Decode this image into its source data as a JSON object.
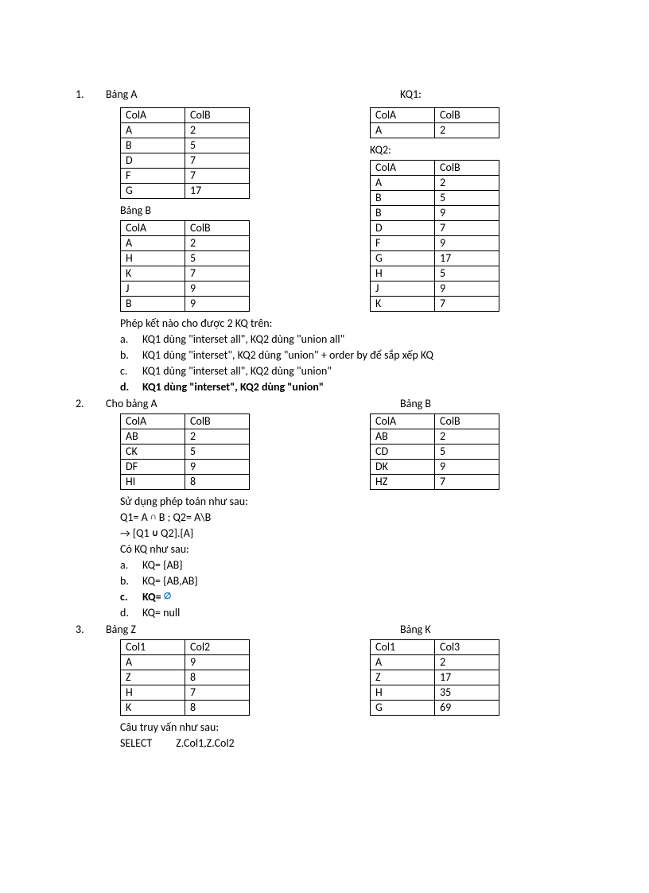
{
  "q1": {
    "num": "1.",
    "titleA": "Bảng A",
    "titleKQ1": "KQ1:",
    "titleB": "Bảng B",
    "titleKQ2": "KQ2:",
    "tableA": {
      "headers": [
        "ColA",
        "ColB"
      ],
      "rows": [
        [
          "A",
          "2"
        ],
        [
          "B",
          "5"
        ],
        [
          "D",
          "7"
        ],
        [
          "F",
          "7"
        ],
        [
          "G",
          "17"
        ]
      ]
    },
    "tableKQ1": {
      "headers": [
        "ColA",
        "ColB"
      ],
      "rows": [
        [
          "A",
          "2"
        ]
      ]
    },
    "tableB": {
      "headers": [
        "ColA",
        "ColB"
      ],
      "rows": [
        [
          "A",
          "2"
        ],
        [
          "H",
          "5"
        ],
        [
          "K",
          "7"
        ],
        [
          "J",
          "9"
        ],
        [
          "B",
          "9"
        ]
      ]
    },
    "tableKQ2": {
      "headers": [
        "ColA",
        "ColB"
      ],
      "rows": [
        [
          "A",
          "2"
        ],
        [
          "B",
          "5"
        ],
        [
          "B",
          "9"
        ],
        [
          "D",
          "7"
        ],
        [
          "F",
          "9"
        ],
        [
          "G",
          "17"
        ],
        [
          "H",
          "5"
        ],
        [
          "J",
          "9"
        ],
        [
          "K",
          "7"
        ]
      ]
    },
    "question": "Phép kết nào cho được 2 KQ trên:",
    "opts": {
      "a": "KQ1 dùng \"interset all\", KQ2 dùng \"union all\"",
      "b": "KQ1 dùng \"interset\", KQ2 dùng \"union\" + order by để sắp xếp KQ",
      "c": "KQ1 dùng \"interset all\", KQ2 dùng \"union\"",
      "d": "KQ1 dùng \"interset\", KQ2 dùng \"union\""
    }
  },
  "q2": {
    "num": "2.",
    "titleA": "Cho bảng A",
    "titleB": "Bảng B",
    "tableA": {
      "headers": [
        "ColA",
        "ColB"
      ],
      "rows": [
        [
          "AB",
          "2"
        ],
        [
          "CK",
          "5"
        ],
        [
          "DF",
          "9"
        ],
        [
          "HI",
          "8"
        ]
      ]
    },
    "tableB": {
      "headers": [
        "ColA",
        "ColB"
      ],
      "rows": [
        [
          "AB",
          "2"
        ],
        [
          "CD",
          "5"
        ],
        [
          "DK",
          "9"
        ],
        [
          "HZ",
          "7"
        ]
      ]
    },
    "desc1": "Sử dụng phép toán như sau:",
    "math1a": "Q1= A ",
    "math1b": " B ; Q2= A\\B",
    "intersect": "∩",
    "arrow": "→",
    "math2a": "   [Q1 ",
    "union": "∪",
    "math2b": " Q2].{A}",
    "desc2": "Có KQ như sau:",
    "opts": {
      "a": "KQ= {AB}",
      "b": "KQ= {AB,AB}",
      "c_pre": "KQ= ",
      "c_sym": "∅",
      "d": "KQ= null"
    }
  },
  "q3": {
    "num": "3.",
    "titleZ": "Bảng Z",
    "titleK": "Bảng K",
    "tableZ": {
      "headers": [
        "Col1",
        "Col2"
      ],
      "rows": [
        [
          "A",
          "9"
        ],
        [
          "Z",
          "8"
        ],
        [
          "H",
          "7"
        ],
        [
          "K",
          "8"
        ]
      ]
    },
    "tableK": {
      "headers": [
        "Col1",
        "Col3"
      ],
      "rows": [
        [
          "A",
          "2"
        ],
        [
          "Z",
          "17"
        ],
        [
          "H",
          "35"
        ],
        [
          "G",
          "69"
        ]
      ]
    },
    "desc1": "Câu truy vấn như sau:",
    "sql_kw": "SELECT",
    "sql_rest": "Z.Col1,Z.Col2"
  }
}
